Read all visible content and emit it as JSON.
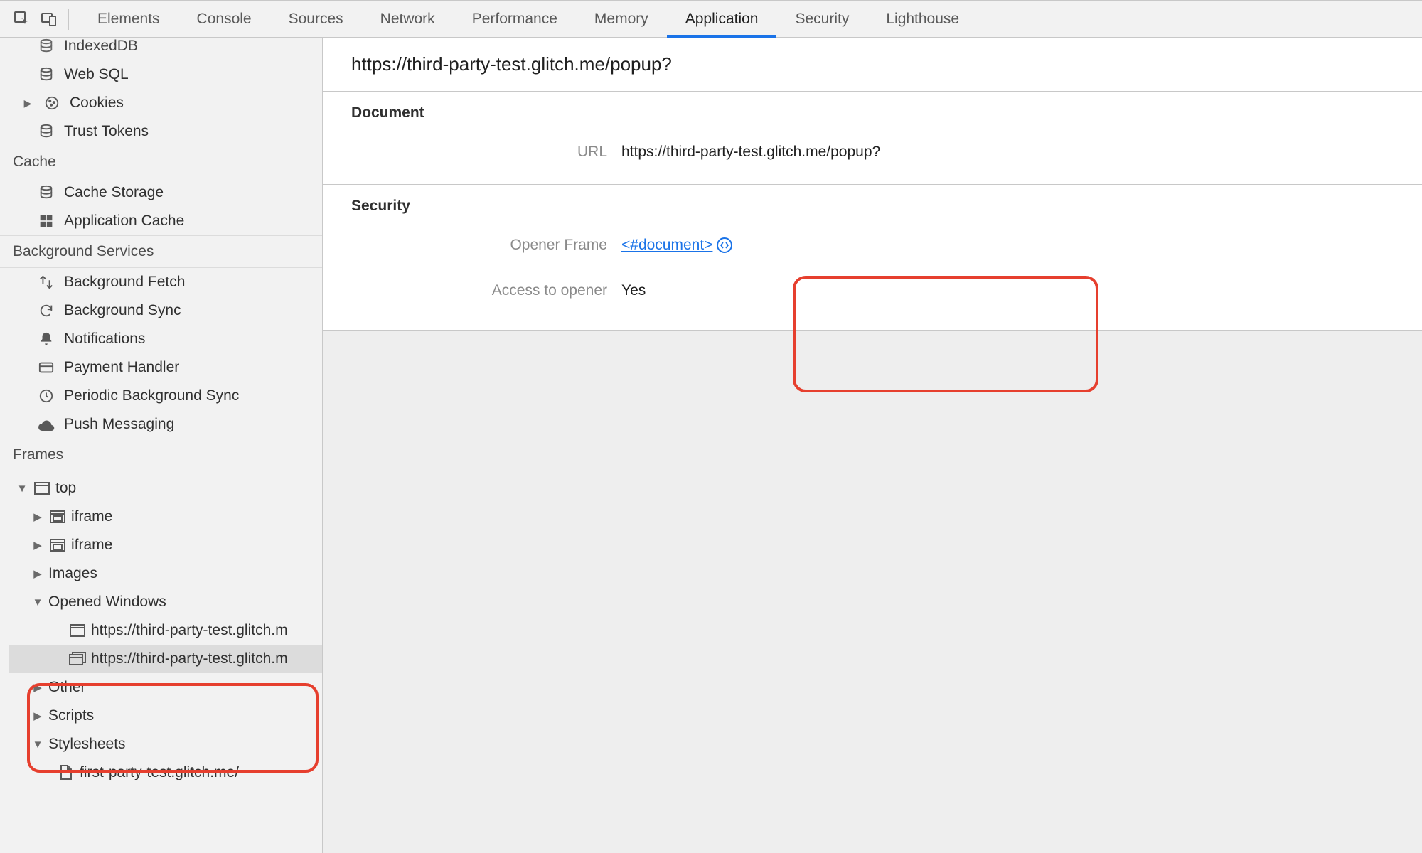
{
  "tabs": {
    "items": [
      "Elements",
      "Console",
      "Sources",
      "Network",
      "Performance",
      "Memory",
      "Application",
      "Security",
      "Lighthouse"
    ],
    "active": "Application"
  },
  "sidebar": {
    "storage_items": {
      "indexed_db": "IndexedDB",
      "web_sql": "Web SQL",
      "cookies": "Cookies",
      "trust_tokens": "Trust Tokens"
    },
    "cache_heading": "Cache",
    "cache_items": {
      "cache_storage": "Cache Storage",
      "application_cache": "Application Cache"
    },
    "background_heading": "Background Services",
    "background_items": {
      "background_fetch": "Background Fetch",
      "background_sync": "Background Sync",
      "notifications": "Notifications",
      "payment_handler": "Payment Handler",
      "periodic_background_sync": "Periodic Background Sync",
      "push_messaging": "Push Messaging"
    },
    "frames_heading": "Frames",
    "frames_tree": {
      "top": "top",
      "iframe1": "iframe",
      "iframe2": "iframe",
      "images": "Images",
      "opened_windows": "Opened Windows",
      "window1": "https://third-party-test.glitch.m",
      "window2": "https://third-party-test.glitch.m",
      "other": "Other",
      "scripts": "Scripts",
      "stylesheets": "Stylesheets",
      "stylesheet_item": "first-party-test.glitch.me/"
    }
  },
  "details": {
    "title": "https://third-party-test.glitch.me/popup?",
    "document_section": "Document",
    "document_url_label": "URL",
    "document_url_value": "https://third-party-test.glitch.me/popup?",
    "security_section": "Security",
    "opener_frame_label": "Opener Frame",
    "opener_frame_value": "<#document>",
    "access_label": "Access to opener",
    "access_value": "Yes"
  }
}
